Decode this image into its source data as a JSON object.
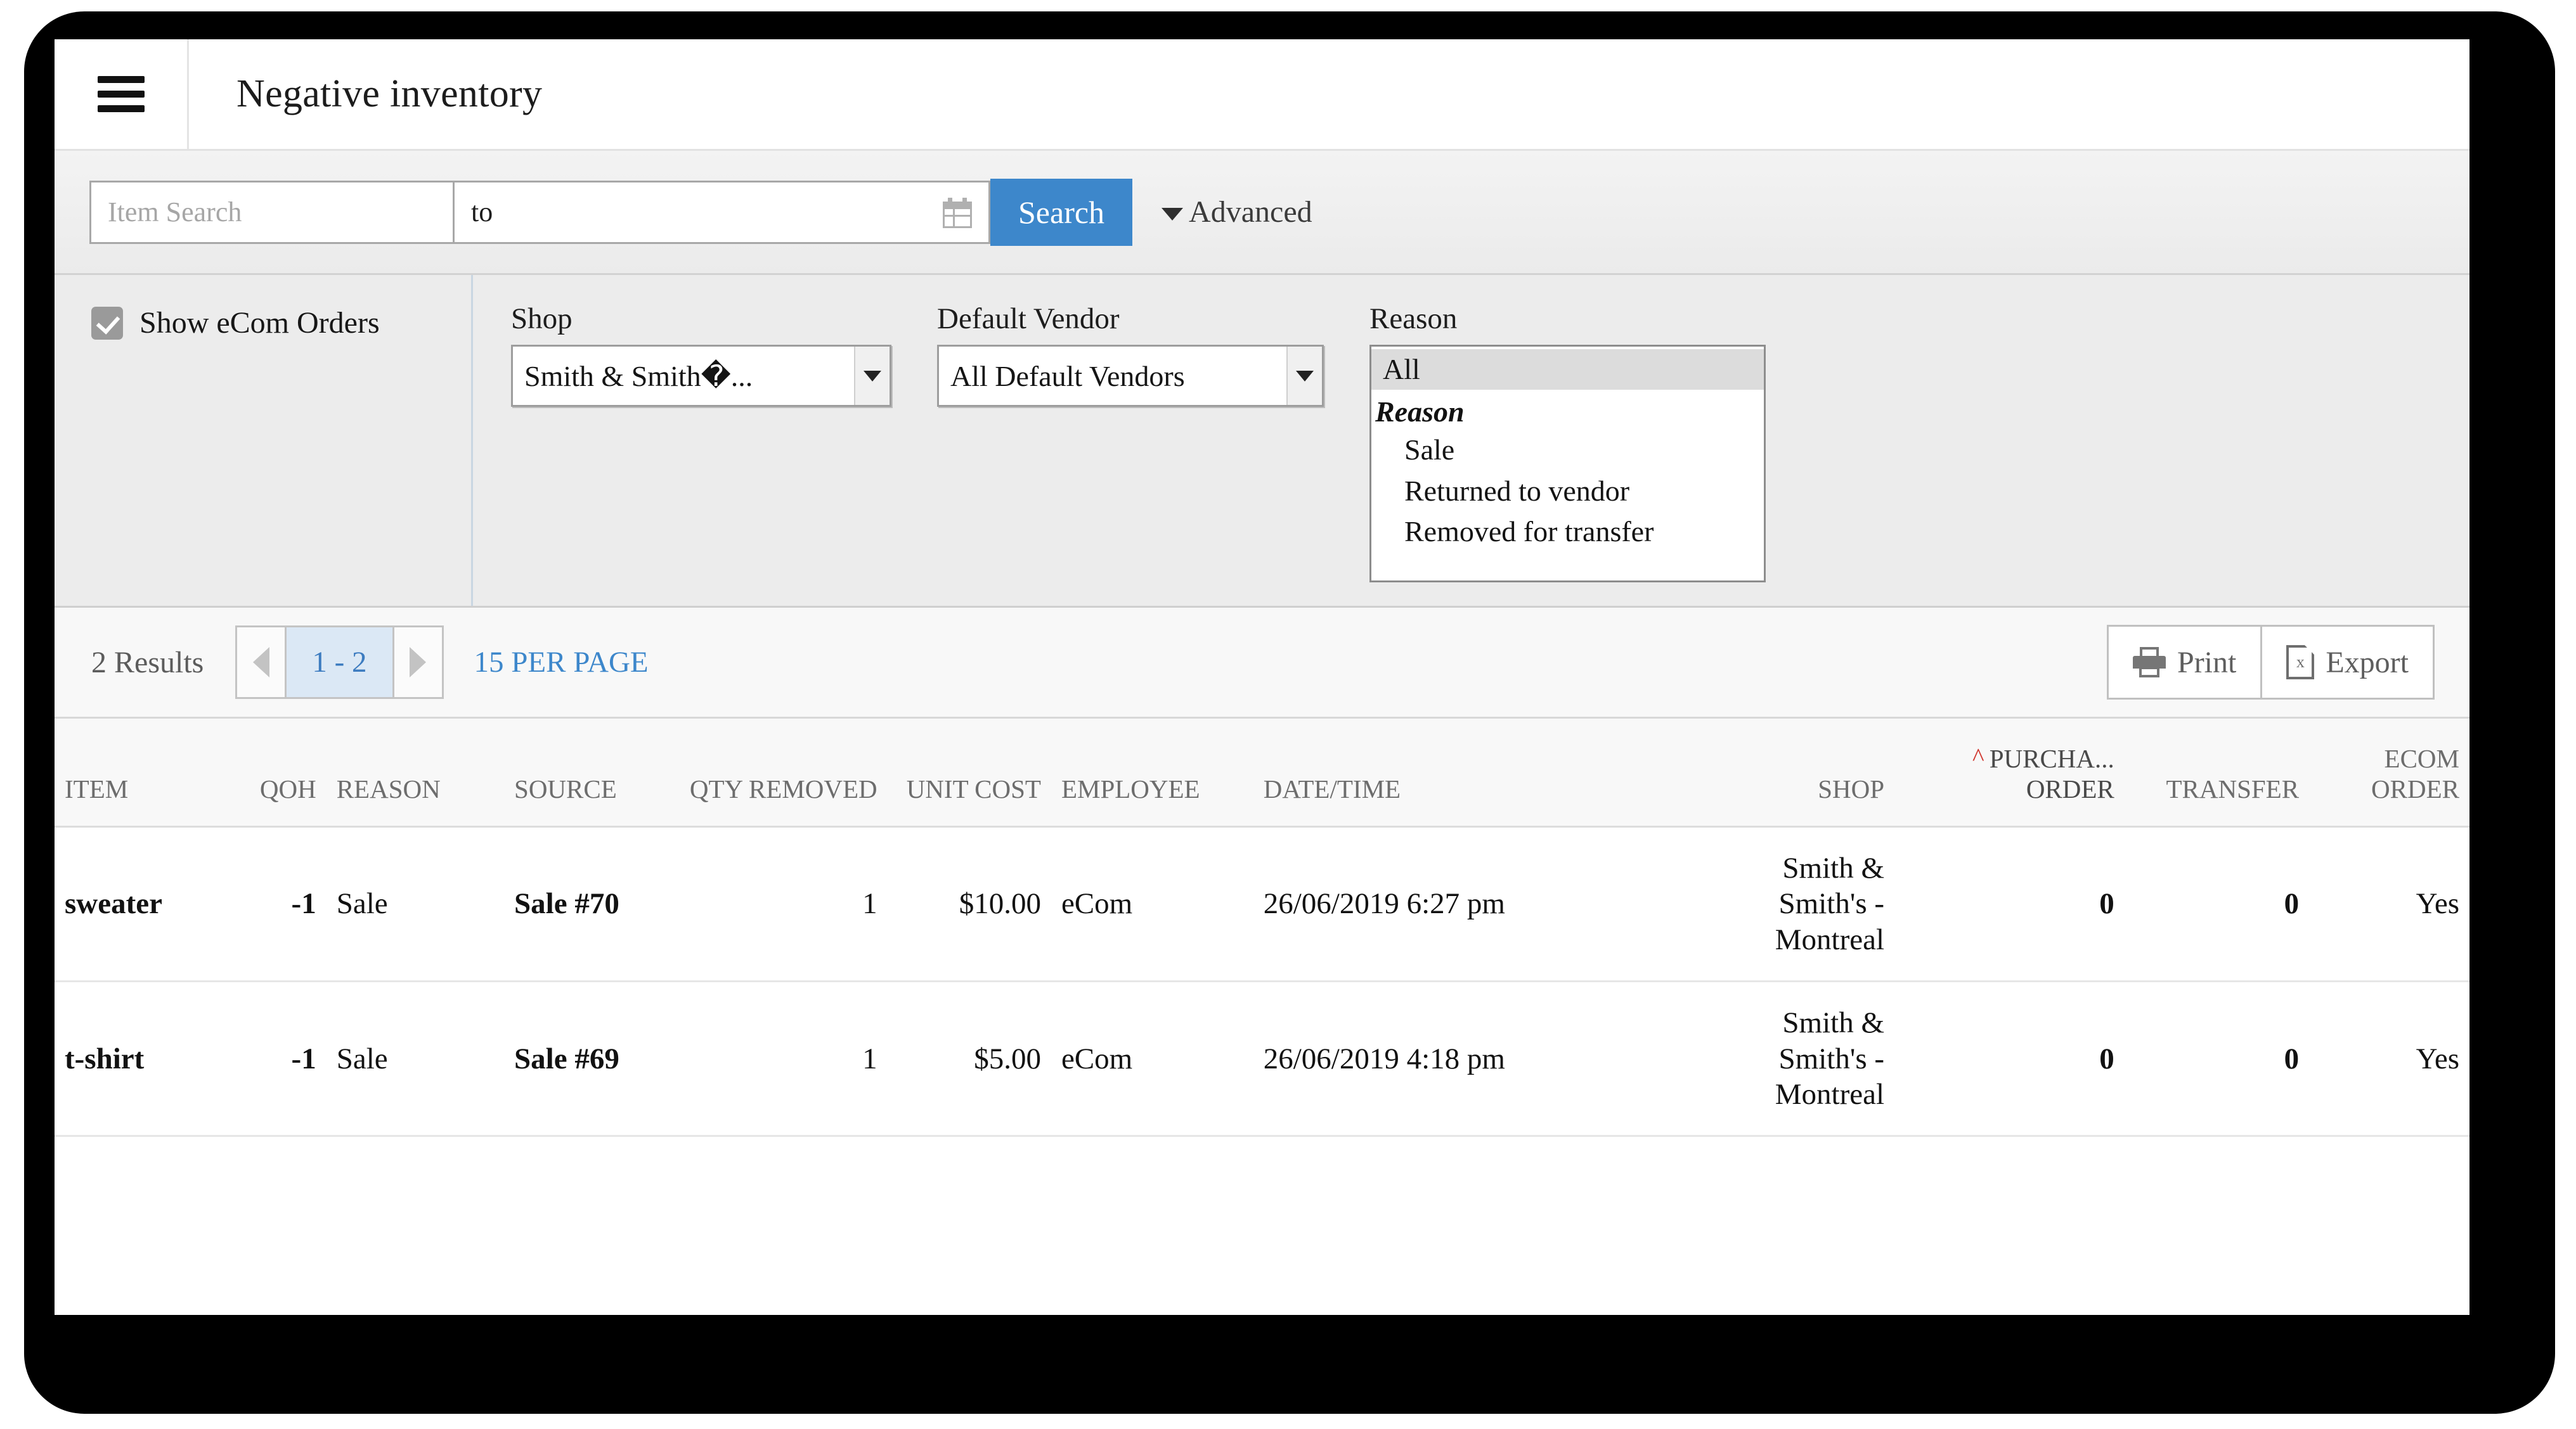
{
  "header": {
    "menu_icon": "hamburger-icon",
    "title": "Negative inventory"
  },
  "search": {
    "item_search_placeholder": "Item Search",
    "item_search_value": "",
    "date_range_value": "to",
    "calendar_icon": "calendar-icon",
    "search_button": "Search",
    "advanced_label": "Advanced",
    "advanced_icon": "chevron-down-icon"
  },
  "filters": {
    "show_ecom_orders_label": "Show eCom Orders",
    "show_ecom_orders_checked": true,
    "shop": {
      "label": "Shop",
      "value": "Smith & Smith�..."
    },
    "vendor": {
      "label": "Default Vendor",
      "value": "All Default Vendors"
    },
    "reason": {
      "label": "Reason",
      "selected": "All",
      "group_label": "Reason",
      "options": [
        "Sale",
        "Returned to vendor",
        "Removed for transfer"
      ]
    }
  },
  "toolbar": {
    "results_count": "2 Results",
    "page_range": "1 - 2",
    "per_page": "15 PER PAGE",
    "print_label": "Print",
    "export_label": "Export",
    "print_icon": "printer-icon",
    "export_icon": "excel-file-icon",
    "prev_icon": "triangle-left-icon",
    "next_icon": "triangle-right-icon"
  },
  "table": {
    "columns": [
      {
        "key": "item",
        "label": "ITEM",
        "align": "left"
      },
      {
        "key": "qoh",
        "label": "QOH",
        "align": "right"
      },
      {
        "key": "reason",
        "label": "REASON",
        "align": "left"
      },
      {
        "key": "source",
        "label": "SOURCE",
        "align": "left"
      },
      {
        "key": "qty_removed",
        "label": "QTY REMOVED",
        "align": "right"
      },
      {
        "key": "unit_cost",
        "label": "UNIT COST",
        "align": "right"
      },
      {
        "key": "employee",
        "label": "EMPLOYEE",
        "align": "left"
      },
      {
        "key": "datetime",
        "label": "DATE/TIME",
        "align": "left"
      },
      {
        "key": "shop",
        "label": "SHOP",
        "align": "right"
      },
      {
        "key": "purchase_order",
        "label": "PURCHA... ORDER",
        "align": "right",
        "sorted": true,
        "sort_dir": "asc"
      },
      {
        "key": "transfer",
        "label": "TRANSFER",
        "align": "right"
      },
      {
        "key": "ecom_order",
        "label": "ECOM ORDER",
        "align": "right"
      }
    ],
    "rows": [
      {
        "item": "sweater",
        "qoh": "-1",
        "reason": "Sale",
        "source": "Sale #70",
        "qty_removed": "1",
        "unit_cost": "$10.00",
        "employee": "eCom",
        "datetime": "26/06/2019 6:27 pm",
        "shop": "Smith & Smith's - Montreal",
        "purchase_order": "0",
        "transfer": "0",
        "ecom_order": "Yes"
      },
      {
        "item": "t-shirt",
        "qoh": "-1",
        "reason": "Sale",
        "source": "Sale #69",
        "qty_removed": "1",
        "unit_cost": "$5.00",
        "employee": "eCom",
        "datetime": "26/06/2019 4:18 pm",
        "shop": "Smith & Smith's - Montreal",
        "purchase_order": "0",
        "transfer": "0",
        "ecom_order": "Yes"
      }
    ]
  },
  "colors": {
    "accent_blue": "#3d87cb",
    "link_blue": "#2b6cb3",
    "sort_red": "#d0342c"
  }
}
